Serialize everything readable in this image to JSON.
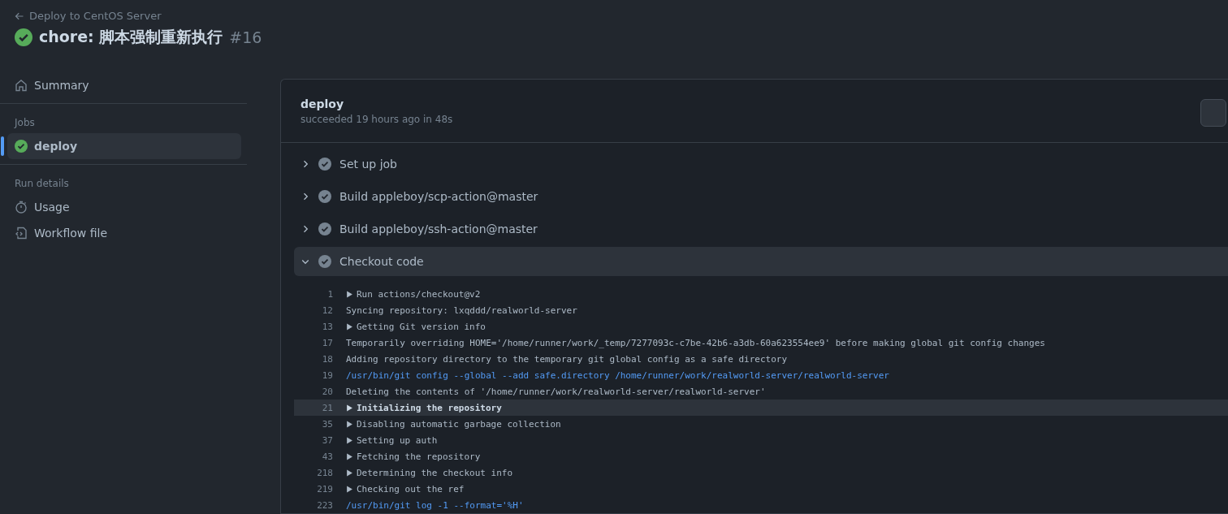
{
  "header": {
    "back_link": "Deploy to CentOS Server",
    "title": "chore: 脚本强制重新执行",
    "run_number": "#16",
    "succeeded": true
  },
  "sidebar": {
    "summary": {
      "label": "Summary",
      "selected": false
    },
    "sections": [
      {
        "title": "Jobs",
        "items": [
          {
            "label": "deploy",
            "kind": "job",
            "selected": true
          }
        ]
      },
      {
        "title": "Run details",
        "items": [
          {
            "label": "Usage",
            "kind": "usage",
            "selected": false
          },
          {
            "label": "Workflow file",
            "kind": "workflow",
            "selected": false
          }
        ]
      }
    ]
  },
  "job": {
    "name": "deploy",
    "status_text": "succeeded 19 hours ago in 48s",
    "steps": [
      {
        "label": "Set up job",
        "expanded": false
      },
      {
        "label": "Build appleboy/scp-action@master",
        "expanded": false
      },
      {
        "label": "Build appleboy/ssh-action@master",
        "expanded": false
      },
      {
        "label": "Checkout code",
        "expanded": true,
        "log": [
          {
            "number": "1",
            "text": "Run actions/checkout@v2",
            "kind": "group",
            "selected": false
          },
          {
            "number": "12",
            "text": "Syncing repository: lxqddd/realworld-server",
            "kind": "plain",
            "selected": false
          },
          {
            "number": "13",
            "text": "Getting Git version info",
            "kind": "group",
            "selected": false
          },
          {
            "number": "17",
            "text": "Temporarily overriding HOME='/home/runner/work/_temp/7277093c-c7be-42b6-a3db-60a623554ee9' before making global git config changes",
            "kind": "plain",
            "selected": false
          },
          {
            "number": "18",
            "text": "Adding repository directory to the temporary git global config as a safe directory",
            "kind": "plain",
            "selected": false
          },
          {
            "number": "19",
            "text": "/usr/bin/git config --global --add safe.directory /home/runner/work/realworld-server/realworld-server",
            "kind": "command",
            "selected": false
          },
          {
            "number": "20",
            "text": "Deleting the contents of '/home/runner/work/realworld-server/realworld-server'",
            "kind": "plain",
            "selected": false
          },
          {
            "number": "21",
            "text": "Initializing the repository",
            "kind": "group",
            "selected": true
          },
          {
            "number": "35",
            "text": "Disabling automatic garbage collection",
            "kind": "group",
            "selected": false
          },
          {
            "number": "37",
            "text": "Setting up auth",
            "kind": "group",
            "selected": false
          },
          {
            "number": "43",
            "text": "Fetching the repository",
            "kind": "group",
            "selected": false
          },
          {
            "number": "218",
            "text": "Determining the checkout info",
            "kind": "group",
            "selected": false
          },
          {
            "number": "219",
            "text": "Checking out the ref",
            "kind": "group",
            "selected": false
          },
          {
            "number": "223",
            "text": "/usr/bin/git log -1 --format='%H'",
            "kind": "command",
            "selected": false
          }
        ]
      }
    ]
  }
}
